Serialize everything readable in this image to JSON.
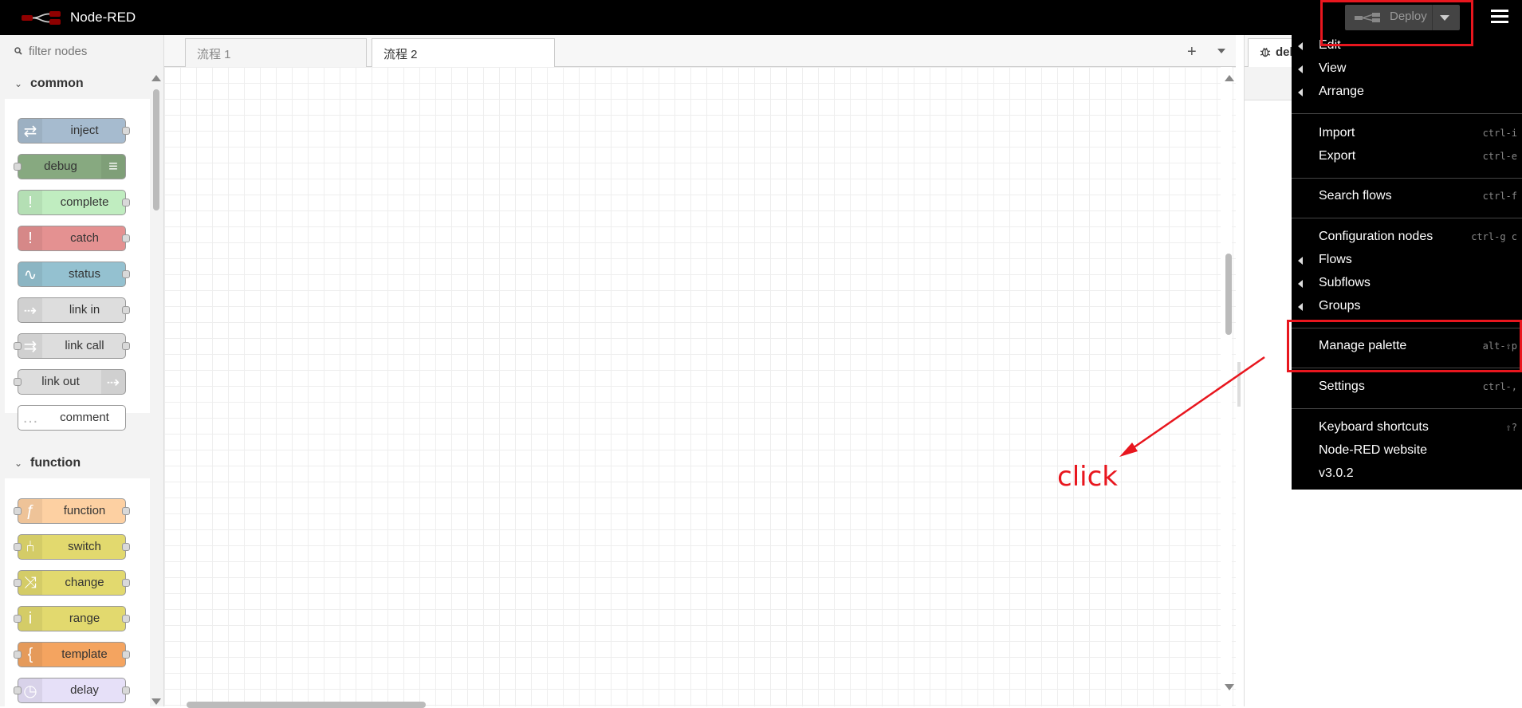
{
  "header": {
    "app_title": "Node-RED",
    "deploy_label": "Deploy"
  },
  "palette": {
    "filter_placeholder": "filter nodes",
    "categories": [
      {
        "label": "common"
      },
      {
        "label": "function"
      }
    ],
    "common_nodes": [
      {
        "label": "inject",
        "color": "#a6bbcf"
      },
      {
        "label": "debug",
        "color": "#87a980"
      },
      {
        "label": "complete",
        "color": "#c0edc0"
      },
      {
        "label": "catch",
        "color": "#e49191"
      },
      {
        "label": "status",
        "color": "#94c1d0"
      },
      {
        "label": "link in",
        "color": "#dddddd"
      },
      {
        "label": "link call",
        "color": "#dddddd"
      },
      {
        "label": "link out",
        "color": "#dddddd"
      },
      {
        "label": "comment",
        "color": "#ffffff"
      }
    ],
    "function_nodes": [
      {
        "label": "function",
        "color": "#fdd0a2"
      },
      {
        "label": "switch",
        "color": "#e2d96e"
      },
      {
        "label": "change",
        "color": "#e2d96e"
      },
      {
        "label": "range",
        "color": "#e2d96e"
      },
      {
        "label": "template",
        "color": "#f4a460"
      },
      {
        "label": "delay",
        "color": "#e6e0f8"
      }
    ]
  },
  "tabs": [
    {
      "label": "流程 1"
    },
    {
      "label": "流程 2"
    }
  ],
  "sidebar": {
    "tab_label": "del"
  },
  "menu": {
    "items": [
      {
        "label": "Edit",
        "shortcut": ""
      },
      {
        "label": "View",
        "shortcut": ""
      },
      {
        "label": "Arrange",
        "shortcut": ""
      },
      {
        "label": "Import",
        "shortcut": "ctrl-i"
      },
      {
        "label": "Export",
        "shortcut": "ctrl-e"
      },
      {
        "label": "Search flows",
        "shortcut": "ctrl-f"
      },
      {
        "label": "Configuration nodes",
        "shortcut": "ctrl-g c"
      },
      {
        "label": "Flows",
        "shortcut": ""
      },
      {
        "label": "Subflows",
        "shortcut": ""
      },
      {
        "label": "Groups",
        "shortcut": ""
      },
      {
        "label": "Manage palette",
        "shortcut": "alt-⇧p"
      },
      {
        "label": "Settings",
        "shortcut": "ctrl-,"
      },
      {
        "label": "Keyboard shortcuts",
        "shortcut": "⇧?"
      },
      {
        "label": "Node-RED website",
        "shortcut": ""
      },
      {
        "label": "v3.0.2",
        "shortcut": ""
      }
    ]
  },
  "annotation": {
    "text": "click",
    "color": "#e8161e"
  }
}
